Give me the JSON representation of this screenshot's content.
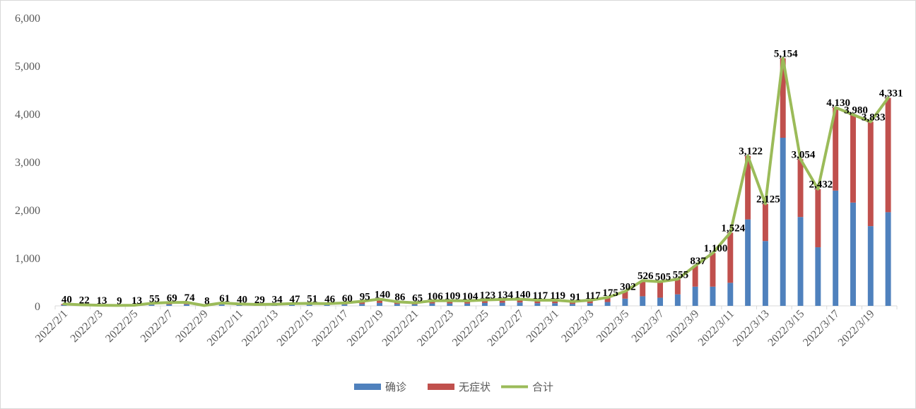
{
  "chart_data": {
    "type": "bar",
    "stacked": true,
    "title": "",
    "xlabel": "",
    "ylabel": "",
    "ylim": [
      0,
      6000
    ],
    "yticks": [
      "0",
      "1,000",
      "2,000",
      "3,000",
      "4,000",
      "5,000",
      "6,000"
    ],
    "grid": false,
    "legend_position": "bottom",
    "categories": [
      "2022/2/1",
      "2022/2/2",
      "2022/2/3",
      "2022/2/4",
      "2022/2/5",
      "2022/2/6",
      "2022/2/7",
      "2022/2/8",
      "2022/2/9",
      "2022/2/10",
      "2022/2/11",
      "2022/2/12",
      "2022/2/13",
      "2022/2/14",
      "2022/2/15",
      "2022/2/16",
      "2022/2/17",
      "2022/2/18",
      "2022/2/19",
      "2022/2/20",
      "2022/2/21",
      "2022/2/22",
      "2022/2/23",
      "2022/2/24",
      "2022/2/25",
      "2022/2/26",
      "2022/2/27",
      "2022/2/28",
      "2022/3/1",
      "2022/3/2",
      "2022/3/3",
      "2022/3/4",
      "2022/3/5",
      "2022/3/6",
      "2022/3/7",
      "2022/3/8",
      "2022/3/9",
      "2022/3/10",
      "2022/3/11",
      "2022/3/12",
      "2022/3/13",
      "2022/3/14",
      "2022/3/15",
      "2022/3/16",
      "2022/3/17",
      "2022/3/18",
      "2022/3/19",
      "2022/3/20"
    ],
    "x_tick_labels": [
      "2022/2/1",
      "2022/2/3",
      "2022/2/5",
      "2022/2/7",
      "2022/2/9",
      "2022/2/11",
      "2022/2/13",
      "2022/2/15",
      "2022/2/17",
      "2022/2/19",
      "2022/2/21",
      "2022/2/23",
      "2022/2/25",
      "2022/2/27",
      "2022/3/1",
      "2022/3/3",
      "2022/3/5",
      "2022/3/7",
      "2022/3/9",
      "2022/3/11",
      "2022/3/13",
      "2022/3/15",
      "2022/3/17",
      "2022/3/19"
    ],
    "series": [
      {
        "name": "确诊",
        "type": "bar",
        "color": "#4f81bd",
        "values": [
          20,
          10,
          6,
          4,
          6,
          25,
          30,
          32,
          4,
          28,
          18,
          14,
          16,
          22,
          24,
          22,
          28,
          40,
          60,
          40,
          30,
          50,
          50,
          48,
          60,
          65,
          70,
          55,
          55,
          40,
          55,
          80,
          150,
          200,
          170,
          240,
          400,
          400,
          480,
          1800,
          1350,
          3500,
          1850,
          1220,
          2400,
          2150,
          1660,
          1950
        ]
      },
      {
        "name": "无症状",
        "type": "bar",
        "color": "#c0504d",
        "values": [
          20,
          12,
          7,
          5,
          7,
          30,
          39,
          42,
          4,
          33,
          22,
          15,
          18,
          25,
          27,
          24,
          32,
          55,
          80,
          46,
          35,
          56,
          59,
          56,
          63,
          69,
          70,
          62,
          64,
          51,
          62,
          95,
          152,
          326,
          335,
          315,
          437,
          700,
          1044,
          1322,
          775,
          1654,
          1204,
          1212,
          1730,
          1830,
          2173,
          2381
        ]
      },
      {
        "name": "合计",
        "type": "line",
        "color": "#9bbb59",
        "values": [
          40,
          22,
          13,
          9,
          13,
          55,
          69,
          74,
          8,
          61,
          40,
          29,
          34,
          47,
          51,
          46,
          60,
          95,
          140,
          86,
          65,
          106,
          109,
          104,
          123,
          134,
          140,
          117,
          119,
          91,
          117,
          175,
          302,
          526,
          505,
          555,
          837,
          1100,
          1524,
          3122,
          2125,
          5154,
          3054,
          2432,
          4130,
          3980,
          3833,
          4331
        ]
      }
    ],
    "data_labels": [
      "40",
      "22",
      "13",
      "9",
      "13",
      "55",
      "69",
      "74",
      "8",
      "61",
      "40",
      "29",
      "34",
      "47",
      "51",
      "46",
      "60",
      "95",
      "140",
      "86",
      "65",
      "106",
      "109",
      "104",
      "123",
      "134",
      "140",
      "117",
      "119",
      "91",
      "117",
      "175",
      "302",
      "526",
      "505",
      "555",
      "837",
      "1,100",
      "1,524",
      "3,122",
      "2,125",
      "5,154",
      "3,054",
      "2,432",
      "4,130",
      "3,980",
      "3,833",
      "4,331"
    ]
  }
}
